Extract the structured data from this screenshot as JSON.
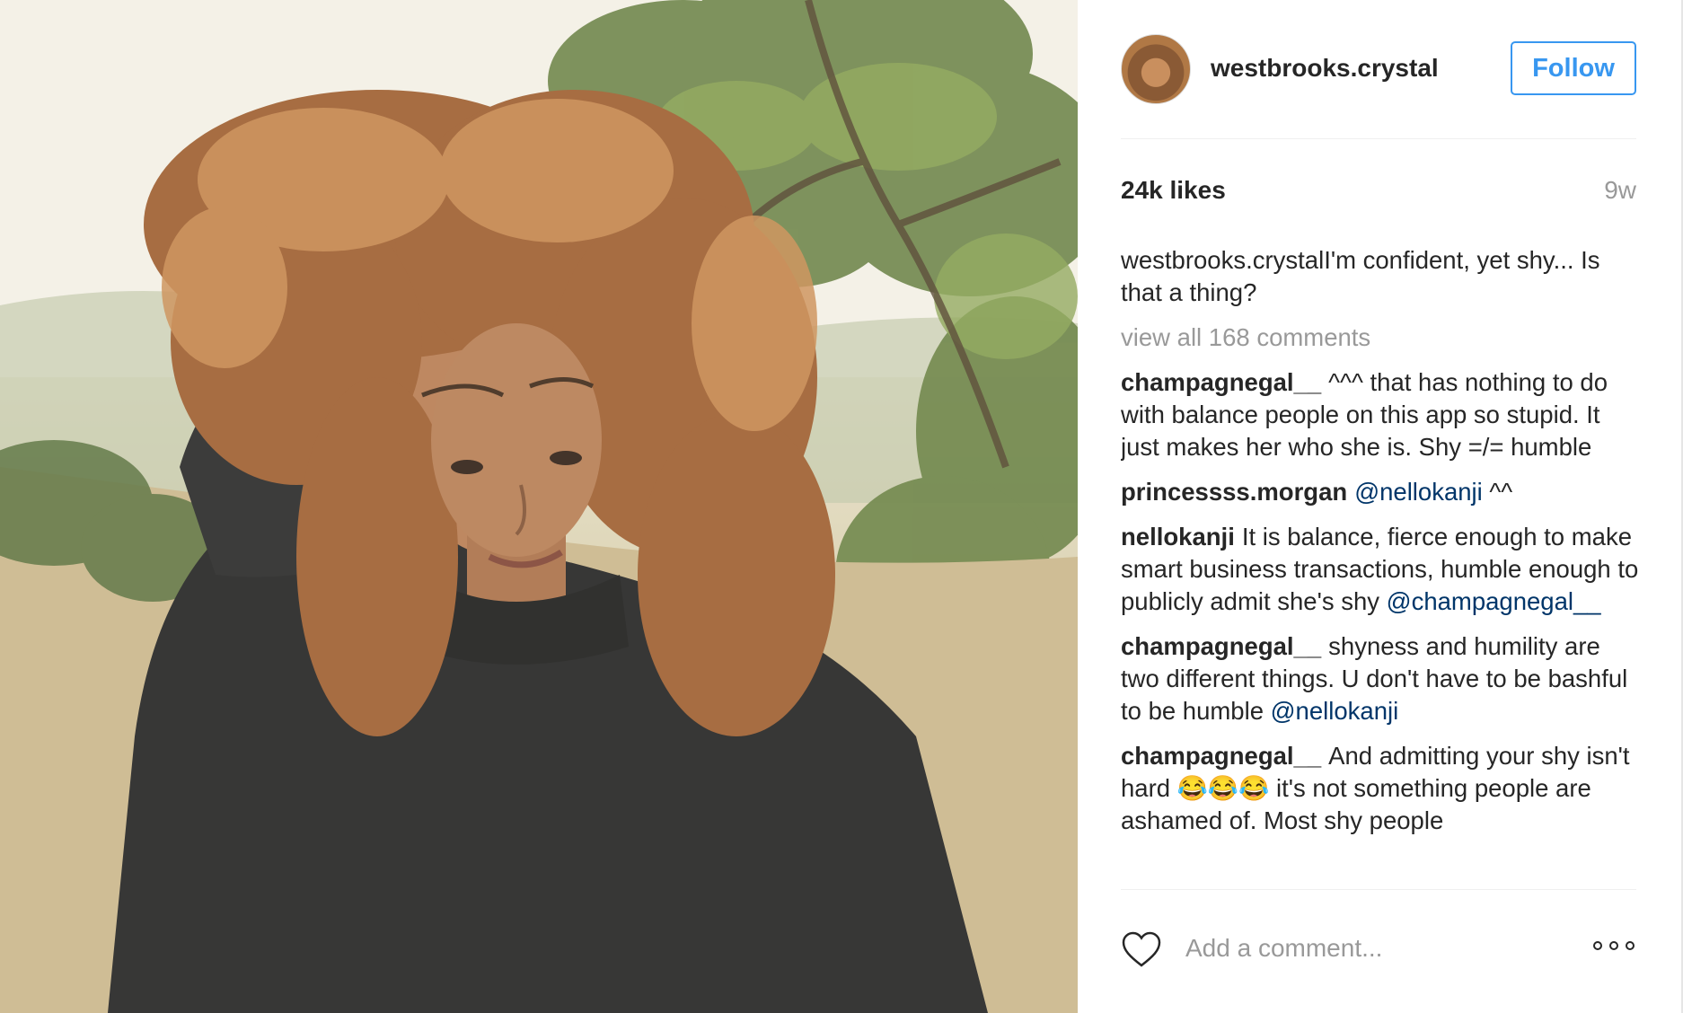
{
  "post": {
    "username": "westbrooks.crystal",
    "follow_label": "Follow",
    "likes": "24k likes",
    "age": "9w",
    "caption": {
      "user": "westbrooks.crystal",
      "text": "I'm confident, yet shy... Is that a thing?"
    },
    "view_all_label": "view all 168 comments",
    "comments": [
      {
        "user": "champagnegal__",
        "text": "^^^ that has nothing to do with balance people on this app so stupid. It just makes her who she is. Shy =/= humble",
        "mention": "",
        "suffix": ""
      },
      {
        "user": "princessss.morgan",
        "text": "",
        "mention": "@nellokanji",
        "suffix": " ^^"
      },
      {
        "user": "nellokanji",
        "text": "It is balance, fierce enough to make smart business transactions, humble enough to publicly admit she's shy ",
        "mention": "@champagnegal__",
        "suffix": ""
      },
      {
        "user": "champagnegal__",
        "text": "shyness and humility are two different things. U don't have to be bashful to be humble ",
        "mention": "@nellokanji",
        "suffix": ""
      },
      {
        "user": "champagnegal__",
        "text": "And admitting your shy isn't hard 😂😂😂 it's not something people are ashamed of. Most shy people",
        "mention": "",
        "suffix": ""
      }
    ],
    "add_comment_placeholder": "Add a comment..."
  },
  "icons": {
    "heart": "heart-icon",
    "more": "more-options-icon"
  },
  "colors": {
    "accent": "#3897f0",
    "mention": "#003569",
    "muted": "#999999",
    "text": "#262626"
  }
}
